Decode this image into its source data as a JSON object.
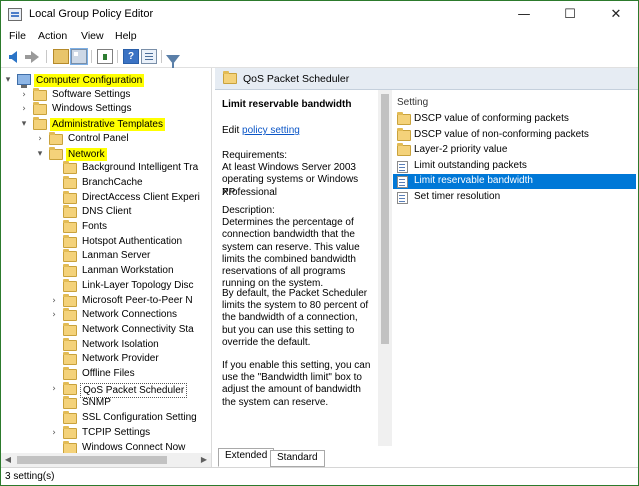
{
  "window": {
    "title": "Local Group Policy Editor",
    "minimize": "—",
    "maximize": "☐",
    "close": "✕"
  },
  "menu": [
    "File",
    "Action",
    "View",
    "Help"
  ],
  "toolbar": {
    "icons": [
      "back-arrow-icon",
      "forward-arrow-icon",
      "up-folder-icon",
      "show-hide-tree-icon",
      "export-list-icon",
      "help-icon",
      "properties-icon",
      "filter-icon"
    ]
  },
  "tree": {
    "items": [
      {
        "label": "Computer Configuration",
        "expander": "▾",
        "highlight": true
      },
      {
        "label": "Software Settings",
        "expander": "›"
      },
      {
        "label": "Windows Settings",
        "expander": "›"
      },
      {
        "label": "Administrative Templates",
        "expander": "▾",
        "highlight": true
      },
      {
        "label": "Control Panel",
        "expander": "›"
      },
      {
        "label": "Network",
        "expander": "▾",
        "highlight": true
      },
      {
        "label": "Background Intelligent Tra",
        "expander": ""
      },
      {
        "label": "BranchCache",
        "expander": ""
      },
      {
        "label": "DirectAccess Client Experi",
        "expander": ""
      },
      {
        "label": "DNS Client",
        "expander": ""
      },
      {
        "label": "Fonts",
        "expander": ""
      },
      {
        "label": "Hotspot Authentication",
        "expander": ""
      },
      {
        "label": "Lanman Server",
        "expander": ""
      },
      {
        "label": "Lanman Workstation",
        "expander": ""
      },
      {
        "label": "Link-Layer Topology Disc",
        "expander": ""
      },
      {
        "label": "Microsoft Peer-to-Peer N",
        "expander": "›"
      },
      {
        "label": "Network Connections",
        "expander": "›"
      },
      {
        "label": "Network Connectivity Sta",
        "expander": ""
      },
      {
        "label": "Network Isolation",
        "expander": ""
      },
      {
        "label": "Network Provider",
        "expander": ""
      },
      {
        "label": "Offline Files",
        "expander": ""
      },
      {
        "label": "QoS Packet Scheduler",
        "expander": "›",
        "highlight": true,
        "selected": true
      },
      {
        "label": "SNMP",
        "expander": ""
      },
      {
        "label": "SSL Configuration Setting",
        "expander": ""
      },
      {
        "label": "TCPIP Settings",
        "expander": "›"
      },
      {
        "label": "Windows Connect Now",
        "expander": ""
      }
    ]
  },
  "right_header": "QoS Packet Scheduler",
  "description": {
    "title": "Limit reservable bandwidth",
    "edit_prefix": "Edit ",
    "edit_link": "policy setting",
    "requirements": [
      "Requirements:",
      "At least Windows Server 2003",
      "operating systems or Windows XP",
      "Professional"
    ],
    "description": [
      "Description:",
      "Determines the percentage of",
      "connection bandwidth that the",
      "system can reserve. This value",
      "limits the combined bandwidth",
      "reservations of all programs",
      "running on the system."
    ],
    "default": [
      "By default, the Packet Scheduler",
      "limits the system to 80 percent of",
      "the bandwidth of a connection,",
      "but you can use this setting to",
      "override the default."
    ],
    "enable": [
      "If you enable this setting, you can",
      "use the \"Bandwidth limit\" box to",
      "adjust the amount of bandwidth",
      "the system can reserve."
    ]
  },
  "list": {
    "column": "Setting",
    "rows": [
      {
        "label": "DSCP value of conforming packets",
        "type": "folder"
      },
      {
        "label": "DSCP value of non-conforming packets",
        "type": "folder"
      },
      {
        "label": "Layer-2 priority value",
        "type": "folder"
      },
      {
        "label": "Limit outstanding packets",
        "type": "setting"
      },
      {
        "label": "Limit reservable bandwidth",
        "type": "setting",
        "selected": true
      },
      {
        "label": "Set timer resolution",
        "type": "setting"
      }
    ]
  },
  "tabs": {
    "extended": "Extended",
    "standard": "Standard"
  },
  "status": "3 setting(s)",
  "colors": {
    "highlight": "#ffff00",
    "selection": "#0078d7",
    "link": "#0b56c7"
  }
}
